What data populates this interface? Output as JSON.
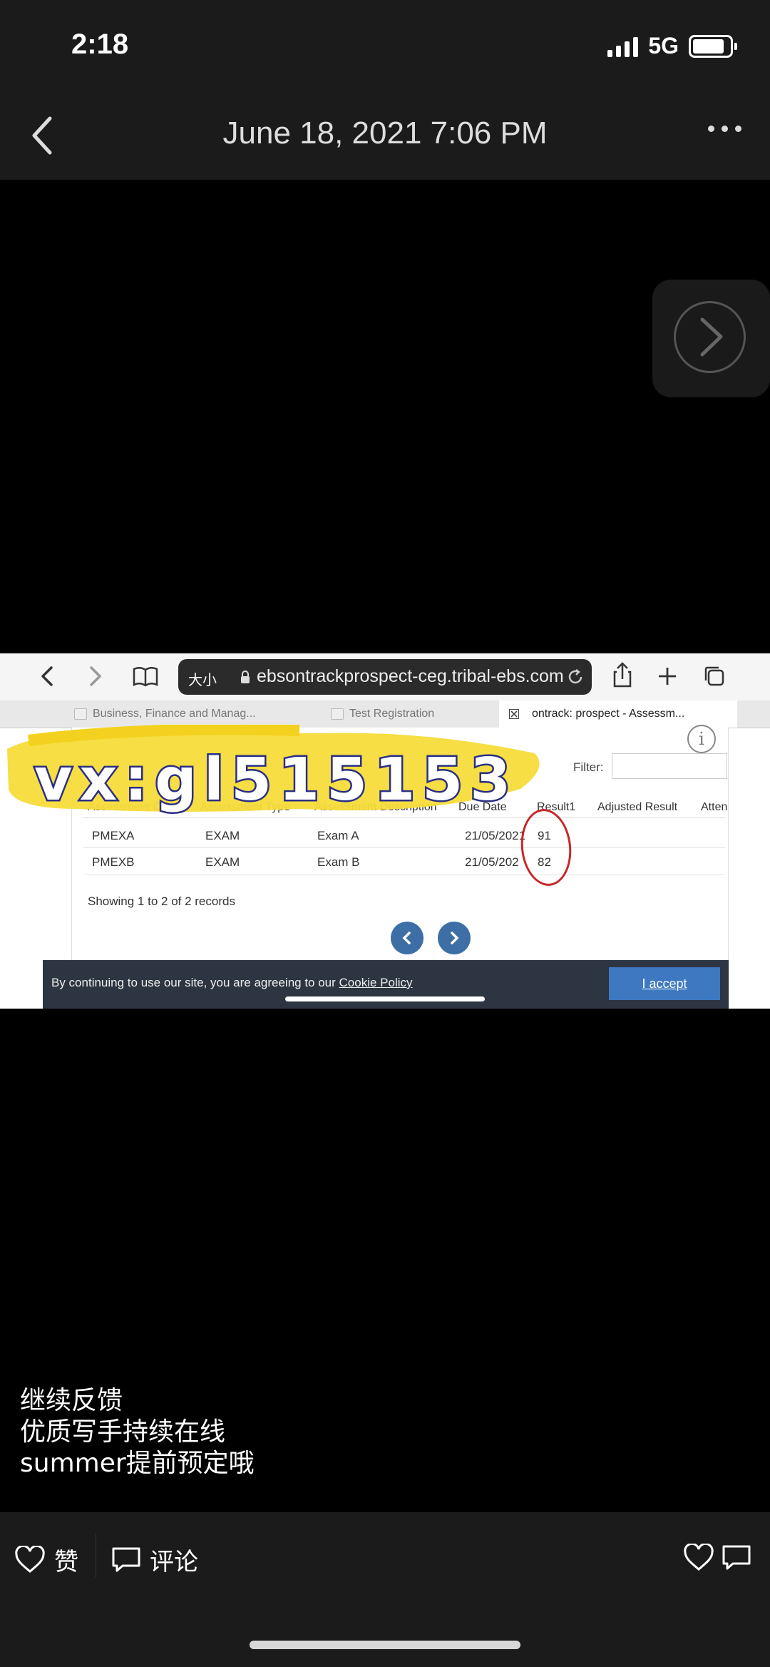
{
  "status_bar": {
    "time": "2:18",
    "network": "5G"
  },
  "nav": {
    "title": "June 18, 2021 7:06 PM",
    "back_icon": "chevron-left-icon",
    "more_icon": "more-icon"
  },
  "overlay": {
    "next_icon": "chevron-right-icon"
  },
  "embedded_screenshot": {
    "browser": {
      "text_size_label": "大小",
      "url": "ebsontrackprospect-ceg.tribal-ebs.com"
    },
    "tabs": [
      {
        "label": "Business, Finance and Manag..."
      },
      {
        "label": "Test Registration"
      },
      {
        "label": "ontrack: prospect - Assessm..."
      }
    ],
    "watermark": "vx:gl515153",
    "filter_label": "Filter:",
    "info_glyph": "i",
    "table": {
      "headers": [
        "Assessment Code",
        "Assessment Type",
        "Assessment Description",
        "Due Date",
        "Result1",
        "Adjusted Result",
        "Atten"
      ],
      "rows": [
        [
          "PMEXA",
          "EXAM",
          "Exam A",
          "21/05/2021",
          "91"
        ],
        [
          "PMEXB",
          "EXAM",
          "Exam B",
          "21/05/202",
          "82"
        ]
      ]
    },
    "records_text": "Showing 1 to 2 of 2 records",
    "cookie": {
      "text": "By continuing to use our site, you are agreeing to our ",
      "link": "Cookie Policy",
      "accept": "I accept"
    }
  },
  "caption": {
    "lines": [
      "继续反馈",
      "优质写手持续在线",
      "summer提前预定哦"
    ]
  },
  "bottom_bar": {
    "like_label": "赞",
    "comment_label": "评论"
  }
}
